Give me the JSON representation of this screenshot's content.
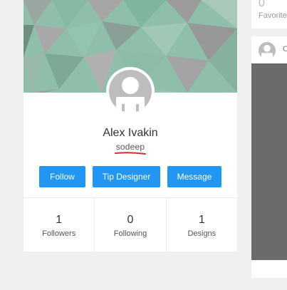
{
  "profile": {
    "name": "Alex Ivakin",
    "username": "sodeep",
    "underline_color": "#d32f2f",
    "avatar_icon": "user-avatar-icon",
    "cover_colors": [
      "#8fbfaa",
      "#9a9a9a",
      "#7fb59f",
      "#a9c9b8",
      "#6e8f80"
    ]
  },
  "actions": {
    "follow_label": "Follow",
    "tip_label": "Tip Designer",
    "message_label": "Message",
    "accent_color": "#2196f3"
  },
  "stats": [
    {
      "value": "1",
      "label": "Followers"
    },
    {
      "value": "0",
      "label": "Following"
    },
    {
      "value": "1",
      "label": "Designs"
    }
  ],
  "favorites": {
    "count": "0",
    "label": "Favorites"
  },
  "post": {
    "label": "C"
  }
}
